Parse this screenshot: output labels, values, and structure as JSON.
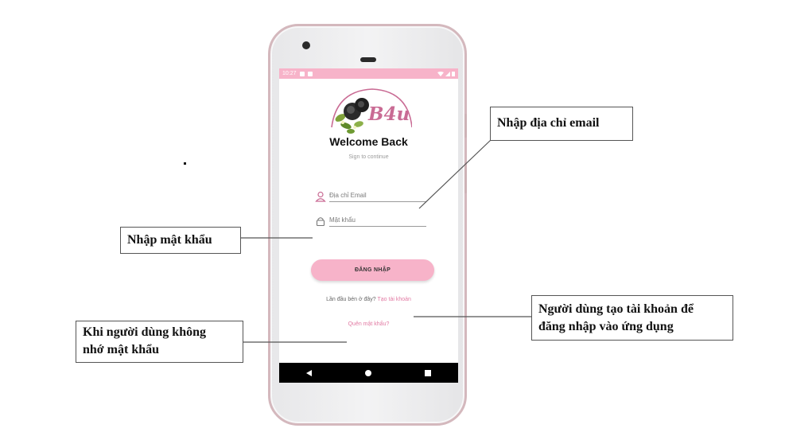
{
  "status_bar": {
    "time": "10:27"
  },
  "app": {
    "logo_text": "B4u",
    "welcome": "Welcome Back",
    "subtitle": "Sign to continue",
    "email_placeholder": "Địa chỉ Email",
    "password_placeholder": "Mật khẩu",
    "login_label": "ĐĂNG NHẬP",
    "signup_prompt": "Lần đầu bén ở đây?",
    "signup_link": "Tạo tài khoản",
    "forgot_label": "Quên mật khẩu?"
  },
  "callouts": {
    "email": "Nhập địa chỉ email",
    "password": "Nhập mật khẩu",
    "signup_line1": "Người dùng tạo tài khoản để",
    "signup_line2": "đăng nhập vào ứng dụng",
    "forgot_line1": "Khi người dùng không",
    "forgot_line2": "nhớ mật khẩu"
  },
  "colors": {
    "accent": "#f7b3c9",
    "link": "#e27aa3",
    "logo": "#c96b94"
  },
  "icons": [
    "user-icon",
    "lock-icon",
    "rose-logo-icon",
    "back-icon",
    "home-icon",
    "recent-apps-icon"
  ]
}
